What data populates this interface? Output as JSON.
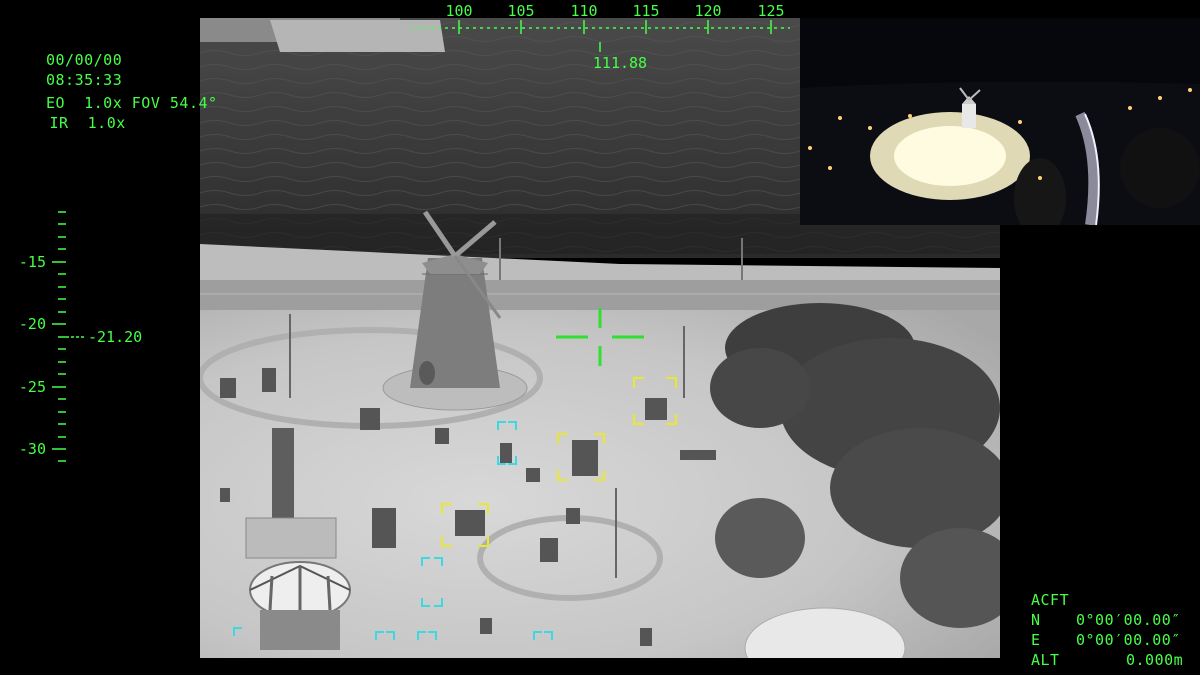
{
  "overlay": {
    "date": "00/00/00",
    "time": "08:35:33",
    "eo_line": "EO  1.0x FOV 54.4°",
    "ir_line": " IR  1.0x"
  },
  "heading_scale": {
    "ticks": [
      "100",
      "105",
      "110",
      "115",
      "120",
      "125"
    ],
    "current": "111.88"
  },
  "pitch_scale": {
    "ticks": [
      "-15",
      "-20",
      "-25",
      "-30"
    ],
    "current": "-21.20"
  },
  "aircraft": {
    "title": "ACFT",
    "n_label": "N",
    "n_value": "0°00′00.00″",
    "e_label": "E",
    "e_value": "0°00′00.00″",
    "alt_label": "ALT",
    "alt_value": "0.000m"
  },
  "colors": {
    "hud": "#46ff46",
    "target_box": "#e8e830",
    "track_box": "#3ed8e0"
  }
}
